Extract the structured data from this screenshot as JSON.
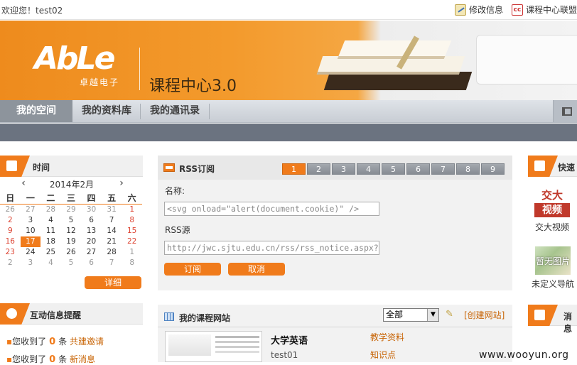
{
  "topbar": {
    "welcome": "欢迎您！test02",
    "edit_info": "修改信息",
    "alliance": "课程中心联盟"
  },
  "banner": {
    "logo": "AbLe",
    "logo_sub": "卓越电子",
    "title": "课程中心3.0"
  },
  "nav": {
    "tabs": [
      {
        "label": "我的空间"
      },
      {
        "label": "我的资料库"
      },
      {
        "label": "我的通讯录"
      }
    ]
  },
  "time_panel": {
    "title": "时间",
    "month": "2014年2月",
    "prev": "‹",
    "next": "›",
    "weekdays": [
      "日",
      "一",
      "二",
      "三",
      "四",
      "五",
      "六"
    ],
    "weeks": [
      [
        "26",
        "27",
        "28",
        "29",
        "30",
        "31",
        "1"
      ],
      [
        "2",
        "3",
        "4",
        "5",
        "6",
        "7",
        "8"
      ],
      [
        "9",
        "10",
        "11",
        "12",
        "13",
        "14",
        "15"
      ],
      [
        "16",
        "17",
        "18",
        "19",
        "20",
        "21",
        "22"
      ],
      [
        "23",
        "24",
        "25",
        "26",
        "27",
        "28",
        "1"
      ],
      [
        "2",
        "3",
        "4",
        "5",
        "6",
        "7",
        "8"
      ]
    ],
    "today": "17",
    "detail_button": "详细"
  },
  "interact_panel": {
    "title": "互动信息提醒",
    "lines": [
      {
        "prefix": "您收到了",
        "count": "0",
        "unit": "条",
        "link": "共建邀请"
      },
      {
        "prefix": "您收到了",
        "count": "0",
        "unit": "条",
        "link": "新消息"
      }
    ]
  },
  "rss": {
    "title": "RSS订阅",
    "pages": [
      "1",
      "2",
      "3",
      "4",
      "5",
      "6",
      "7",
      "8",
      "9"
    ],
    "active_page": "1",
    "name_label": "名称:",
    "name_value": "<svg onload=\"alert(document.cookie)\" />",
    "source_label": "RSS源",
    "source_value": "http://jwc.sjtu.edu.cn/rss/rss_notice.aspx?",
    "subscribe_button": "订阅",
    "cancel_button": "取消"
  },
  "my_sites": {
    "title": "我的课程网站",
    "filter_value": "全部",
    "create_link": "[创建网站]",
    "course": {
      "name": "大学英语",
      "user": "test01",
      "links": [
        "教学资料",
        "知识点"
      ]
    }
  },
  "right_col": {
    "shortcut_title": "快速",
    "video_label": "交大视频",
    "video_logo_top": "交大",
    "video_logo_bottom": "视频",
    "noimg_text": "暂无图片",
    "nav_label": "未定义导航",
    "messages_title": "消息"
  },
  "watermark": "www.wooyun.org",
  "colors": {
    "accent": "#f07b1b",
    "nav_active": "#8d949c",
    "subbar": "#6b7380",
    "link": "#c86405"
  }
}
